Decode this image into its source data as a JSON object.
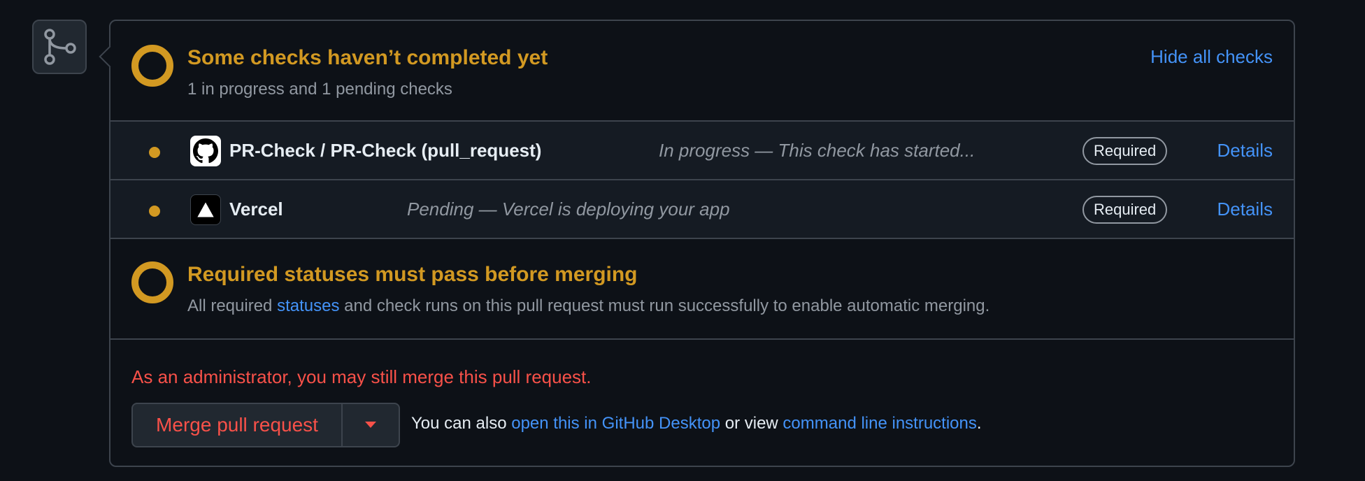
{
  "checks_summary": {
    "title": "Some checks haven’t completed yet",
    "subtitle": "1 in progress and 1 pending checks",
    "toggle_label": "Hide all checks"
  },
  "checks": [
    {
      "name": "PR-Check / PR-Check (pull_request)",
      "description": "In progress — This check has started...",
      "badge": "Required",
      "details_label": "Details",
      "icon": "github-icon"
    },
    {
      "name": "Vercel",
      "description": "Pending — Vercel is deploying your app",
      "badge": "Required",
      "details_label": "Details",
      "icon": "vercel-icon"
    }
  ],
  "required_status": {
    "title": "Required statuses must pass before merging",
    "sub_before": "All required ",
    "sub_link": "statuses",
    "sub_after": " and check runs on this pull request must run successfully to enable automatic merging."
  },
  "merge": {
    "admin_note": "As an administrator, you may still merge this pull request.",
    "button_label": "Merge pull request",
    "hint_before": "You can also ",
    "hint_link_desktop": "open this in GitHub Desktop",
    "hint_middle": " or view ",
    "hint_link_cli": "command line instructions",
    "hint_after": "."
  },
  "colors": {
    "pending": "#d29922",
    "link": "#4493f8",
    "danger": "#f85149",
    "border": "#3d444d",
    "background": "#0d1117"
  }
}
